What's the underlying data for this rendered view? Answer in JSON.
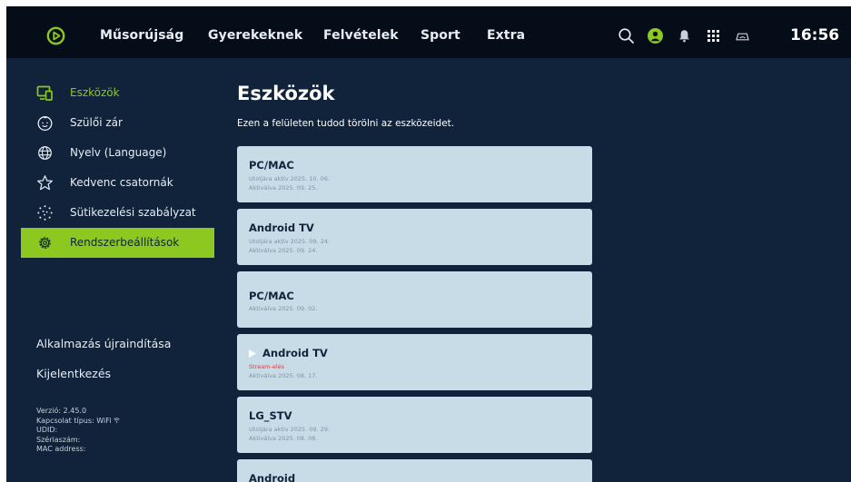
{
  "nav": {
    "items": [
      "Műsorújság",
      "Gyerekeknek",
      "Felvételek",
      "Sport",
      "Extra"
    ],
    "time": "16:56",
    "icons": [
      "search-icon",
      "profile-icon",
      "bell-icon",
      "apps-grid-icon",
      "cast-icon"
    ]
  },
  "sidebar": {
    "items": [
      {
        "label": "Eszközök",
        "icon": "devices-icon",
        "selected": true
      },
      {
        "label": "Szülői zár",
        "icon": "child-face-icon"
      },
      {
        "label": "Nyelv (Language)",
        "icon": "globe-icon"
      },
      {
        "label": "Kedvenc csatornák",
        "icon": "star-icon"
      },
      {
        "label": "Sütikezelési szabályzat",
        "icon": "cookie-icon"
      },
      {
        "label": "Rendszerbeállítások",
        "icon": "gear-icon",
        "focused": true
      }
    ],
    "actions": [
      "Alkalmazás újraindítása",
      "Kijelentkezés"
    ],
    "info": [
      "Verzió: 2.45.0",
      "Kapcsolat típus: WiFi",
      "UDID:",
      "Szériaszám:",
      "MAC address:"
    ]
  },
  "main": {
    "title": "Eszközök",
    "subtitle": "Ezen a felületen tudod törölni az eszközeidet.",
    "devices": [
      {
        "name": "PC/MAC",
        "lines": [
          "Utoljára aktív 2025. 10. 06.",
          "Aktiválva 2025. 09. 25."
        ]
      },
      {
        "name": "Android TV",
        "lines": [
          "Utoljára aktív 2025. 09. 24.",
          "Aktiválva 2025. 09. 24."
        ]
      },
      {
        "name": "PC/MAC",
        "lines": [
          "Aktiválva 2025. 09. 02."
        ]
      },
      {
        "name": "Android TV",
        "status": "Stream-elés",
        "lines": [
          "Aktiválva 2025. 08. 17."
        ],
        "current": true
      },
      {
        "name": "LG_STV",
        "lines": [
          "Utoljára aktív 2025. 09. 29.",
          "Aktiválva 2025. 08. 08."
        ]
      },
      {
        "name": "Android",
        "lines": []
      }
    ]
  },
  "colors": {
    "accent": "#8cc81f",
    "background": "#10233b",
    "topbar": "#050d19",
    "card": "#c8dce8",
    "status": "#e13b3b"
  }
}
